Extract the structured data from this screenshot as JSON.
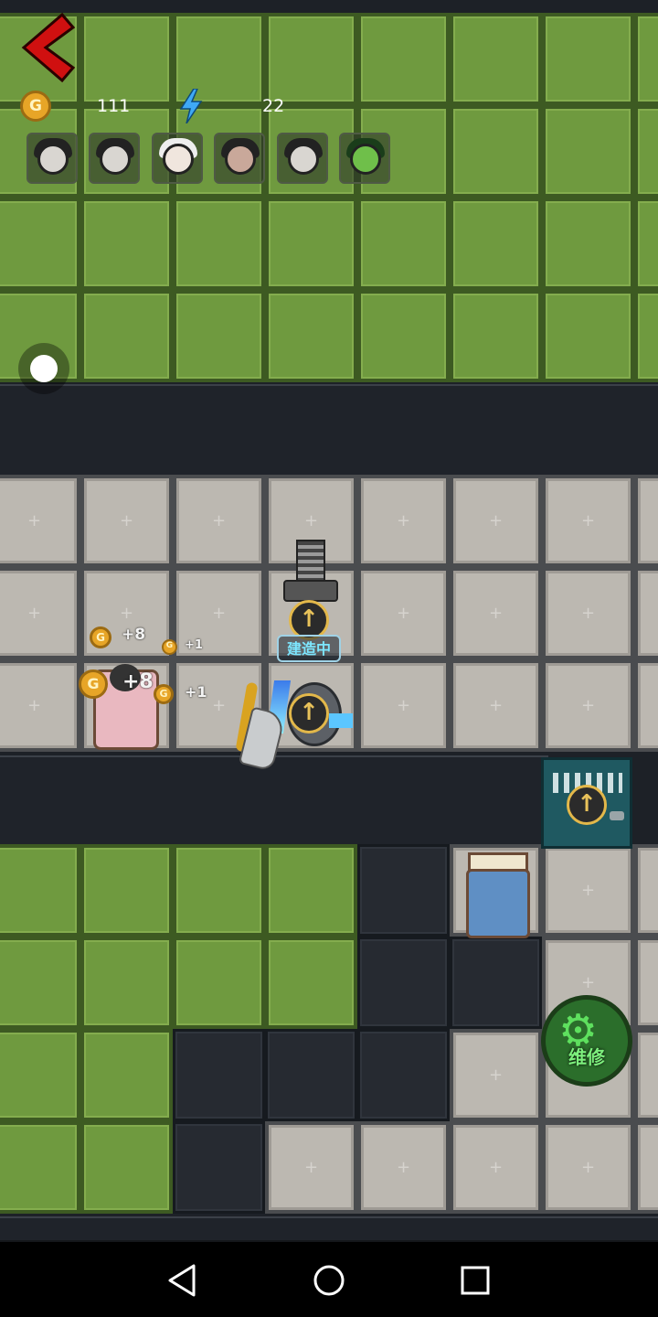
{
  "hud": {
    "gold": "111",
    "energy": "22",
    "coin_glyph": "G",
    "portraits": [
      "girl-dark-hair",
      "maid-bow",
      "elder-white-hair",
      "girl-flower-crown",
      "maid-bow",
      "zombie-green"
    ]
  },
  "map": {
    "building_label": "建造中",
    "floating": {
      "a": "+8",
      "b": "+1",
      "c": "+8",
      "d": "+1"
    },
    "repair_label": "维修"
  },
  "icons": {
    "back": "chevron-left-icon",
    "coin": "coin-icon",
    "energy": "lightning-icon",
    "upgrade": "arrow-up-icon",
    "repair": "wrench-gear-icon"
  },
  "colors": {
    "grass": "#6f9a3f",
    "stone": "#bcb8b1",
    "wall": "#1f232a",
    "accent_gold": "#e7a527",
    "label_cyan": "#7de6ff",
    "repair_green": "#5ee05e"
  }
}
